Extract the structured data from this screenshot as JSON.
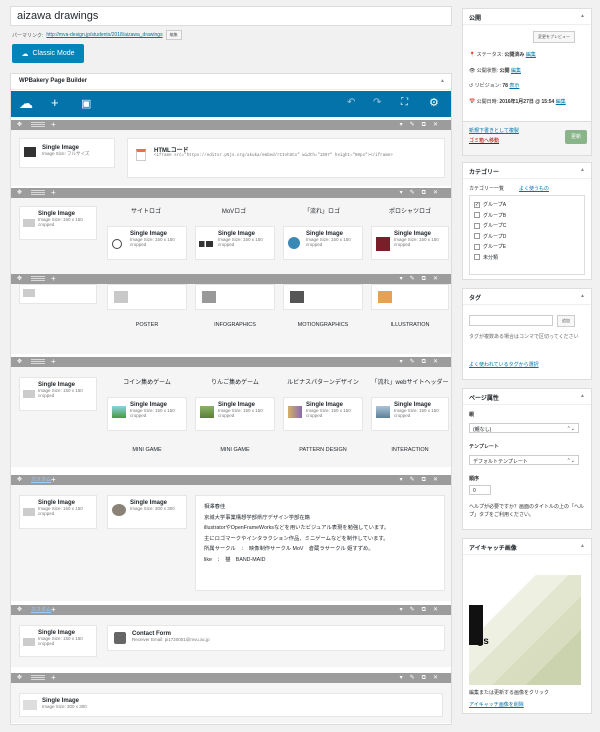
{
  "title": "aizawa drawings",
  "permalink": {
    "label": "パーマリンク:",
    "url": "http://mva-design.jp/students/2018/aizawa_drawings",
    "edit": "編集"
  },
  "classic_mode": "Classic Mode",
  "wpbakery": {
    "title": "WPBakery Page Builder"
  },
  "row1": {
    "image": {
      "title": "Single Image",
      "sub": "Image Size: フルサイズ"
    },
    "html": {
      "title": "HTMLコード",
      "code": "<iframe src=\"https://editor.p5js.org/akuka/embed/rCIvhSCx\" width=\"1597\" height=\"80px\"></iframe>"
    }
  },
  "row2": {
    "image": {
      "title": "Single Image",
      "sub": "Image Size: 150 x 150 cropped"
    },
    "cols": [
      {
        "title": "サイトロゴ",
        "img": "Single Image",
        "sub": "Image Size: 150 x 150 cropped"
      },
      {
        "title": "MoVロゴ",
        "img": "Single Image",
        "sub": "Image Size: 150 x 150 cropped"
      },
      {
        "title": "「流れ」ロゴ",
        "img": "Single Image",
        "sub": "Image Size: 150 x 150 cropped"
      },
      {
        "title": "ポロシャツロゴ",
        "img": "Single Image",
        "sub": "Image Size: 150 x 150 cropped"
      }
    ]
  },
  "row3": {
    "cols": [
      {
        "caption": "POSTER"
      },
      {
        "caption": "INFOGRAPHICS"
      },
      {
        "caption": "MOTIONGRAPHICS"
      },
      {
        "caption": "ILLUSTRATION"
      }
    ]
  },
  "row4": {
    "image": {
      "title": "Single Image",
      "sub": "Image Size: 150 x 150 cropped"
    },
    "cols": [
      {
        "title": "コイン集めゲーム",
        "img": "Single Image",
        "sub": "Image Size: 150 x 150 cropped",
        "caption": "MINI GAME"
      },
      {
        "title": "りんご集めゲーム",
        "img": "Single Image",
        "sub": "Image Size: 150 x 150 cropped",
        "caption": "MINI GAME"
      },
      {
        "title": "ルビナスパターンデザイン",
        "img": "Single Image",
        "sub": "Image Size: 150 x 150 cropped",
        "caption": "PATTERN DESIGN"
      },
      {
        "title": "「流れ」webサイトヘッダー",
        "img": "Single Image",
        "sub": "Image Size: 150 x 150 cropped",
        "caption": "INTERACTION"
      }
    ]
  },
  "row5": {
    "custom": "カスタム",
    "image1": {
      "title": "Single Image",
      "sub": "Image Size: 150 x 150 cropped"
    },
    "image2": {
      "title": "Single Image",
      "sub": "Image Size: 300 x 300"
    },
    "text": [
      "相澤春佳",
      "京城大学事業構想学部県庁デザイン学部在籍",
      "illustratorやOpenFrameWorksなどを用いたビジュアル表現を勉強しています。",
      "主にロゴマークやインタラクション作品、ミニゲームなどを制作しています。",
      "所属サークル　：　映像制作サークル MoV　倉蔵ラサークル 姫すずめ。",
      "like　：　猫　BAND-MAID"
    ]
  },
  "row6": {
    "custom": "カスタム",
    "image": {
      "title": "Single Image",
      "sub": "Image Size: 150 x 150 cropped"
    },
    "form": {
      "title": "Contact Form",
      "sub": "Receiver Email: pi1720001@mvu.ac.jp"
    }
  },
  "row7": {
    "image": {
      "title": "Single Image",
      "sub": "Image Size: 300 x 300"
    }
  },
  "publish": {
    "title": "公開",
    "preview": "変更をプレビュー",
    "status_label": "ステータス:",
    "status_value": "公開済み",
    "status_edit": "編集",
    "visibility_label": "公開状態:",
    "visibility_value": "公開",
    "visibility_edit": "編集",
    "revision_label": "リビジョン:",
    "revision_value": "78",
    "revision_link": "表示",
    "date_label": "公開日時:",
    "date_value": "2016年1月27日 @ 15:54",
    "date_edit": "編集",
    "draft_link": "新規下書きとして複製",
    "trash_link": "ゴミ箱へ移動",
    "update": "更新"
  },
  "category": {
    "title": "カテゴリー",
    "tab_all": "カテゴリー一覧",
    "tab_common": "よく使うもの",
    "items": [
      {
        "label": "グループA",
        "checked": true
      },
      {
        "label": "グループB",
        "checked": false
      },
      {
        "label": "グループC",
        "checked": false
      },
      {
        "label": "グループD",
        "checked": false
      },
      {
        "label": "グループE",
        "checked": false
      },
      {
        "label": "未分類",
        "checked": false
      }
    ]
  },
  "tags": {
    "title": "タグ",
    "add": "追加",
    "help": "タグが複数ある場合はコンマで区切ってください",
    "popular": "よく使われているタグから選択"
  },
  "page_attr": {
    "title": "ページ属性",
    "parent_label": "親",
    "parent_value": "(親なし)",
    "template_label": "テンプレート",
    "template_value": "デフォルトテンプレート",
    "order_label": "順序",
    "order_value": "0",
    "help": "ヘルプが必要ですか？画面のタイトルの上の「ヘルプ」タブをご利用ください。"
  },
  "featured": {
    "title": "アイキャッチ画像",
    "help": "編集または更新する画像をクリック",
    "remove": "アイキャッチ画像を削除"
  },
  "colors": {
    "accent": "#0473aa",
    "bar": "#9c9c9c"
  }
}
